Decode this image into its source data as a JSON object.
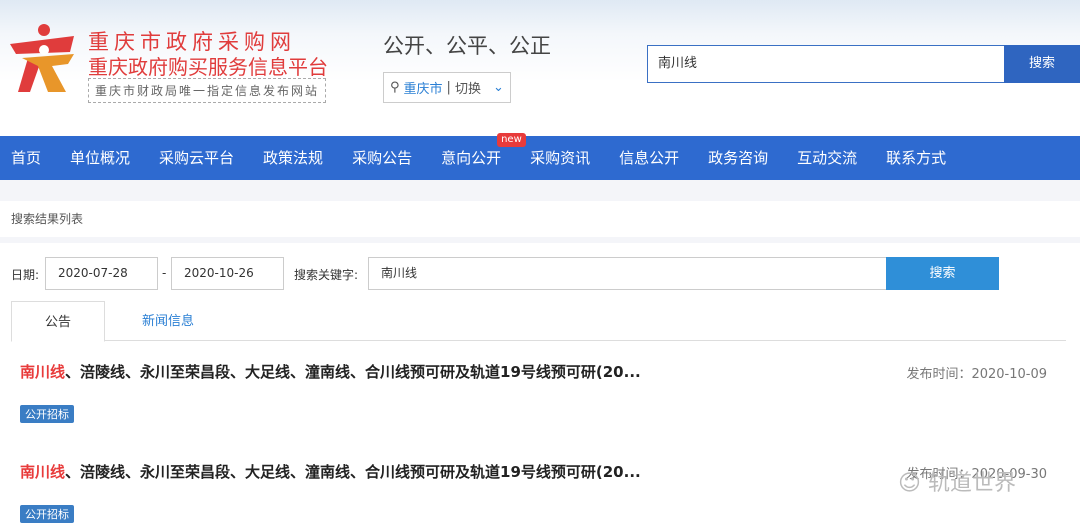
{
  "header": {
    "title1": "重庆市政府采购网",
    "title2": "重庆政府购买服务信息平台",
    "subtitle": "重庆市财政局唯一指定信息发布网站",
    "slogan": "公开、公平、公正",
    "city": "重庆市",
    "switch": "切换",
    "search_value": "南川线",
    "search_button": "搜索"
  },
  "nav": {
    "items": [
      "首页",
      "单位概况",
      "采购云平台",
      "政策法规",
      "采购公告",
      "意向公开",
      "采购资讯",
      "信息公开",
      "政务咨询",
      "互动交流",
      "联系方式"
    ],
    "new_badge": "new"
  },
  "breadcrumb": "搜索结果列表",
  "filter": {
    "date_label": "日期:",
    "date_from": "2020-07-28",
    "date_sep": "-",
    "date_to": "2020-10-26",
    "keyword_label": "搜索关键字:",
    "keyword": "南川线",
    "search_button": "搜索"
  },
  "tabs": [
    "公告",
    "新闻信息"
  ],
  "results": [
    {
      "keyword": "南川线",
      "title_rest": "、涪陵线、永川至荣昌段、大足线、潼南线、合川线预可研及轨道19号线预可研(20...",
      "date": "发布时间：2020-10-09",
      "tag": "公开招标"
    },
    {
      "keyword": "南川线",
      "title_rest": "、涪陵线、永川至荣昌段、大足线、潼南线、合川线预可研及轨道19号线预可研(20...",
      "date": "发布时间：2020-09-30",
      "tag": "公开招标"
    }
  ],
  "watermark": "轨道世界"
}
